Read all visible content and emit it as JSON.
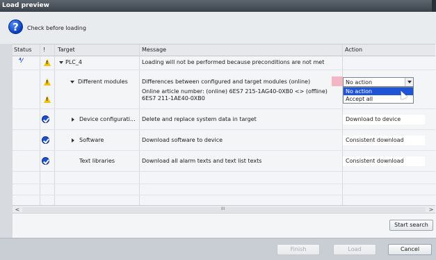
{
  "window": {
    "title": "Load preview"
  },
  "header": {
    "text": "Check before loading"
  },
  "columns": {
    "status": "Status",
    "bang": "!",
    "target": "Target",
    "message": "Message",
    "action": "Action"
  },
  "rows": [
    {
      "target": "PLC_4",
      "message": "Loading will not be performed because preconditions are not met",
      "action": ""
    },
    {
      "target": "Different modules",
      "message": "Differences between configured and target modules (online)",
      "action": "No action"
    },
    {
      "target": "",
      "message_line1": "Online article number: (online) 6ES7 215-1AG40-0XB0 <> (offline)",
      "message_line2": "6ES7 211-1AE40-0XB0",
      "action": ""
    },
    {
      "target": "Device configurati...",
      "message": "Delete and replace system data in target",
      "action": "Download to device"
    },
    {
      "target": "Software",
      "message": "Download software to device",
      "action": "Consistent download"
    },
    {
      "target": "Text libraries",
      "message": "Download all alarm texts and text list texts",
      "action": "Consistent download"
    }
  ],
  "dropdown": {
    "selected": "No action",
    "options": [
      "No action",
      "Accept all"
    ]
  },
  "scrollbar": {
    "left_arrow": "<",
    "right_arrow": ">",
    "grip": "III"
  },
  "buttons": {
    "start_search": "Start search",
    "finish": "Finish",
    "load": "Load",
    "cancel": "Cancel"
  },
  "colors": {
    "titlebar": "#3b4249",
    "selection": "#1f54d6",
    "warning": "#f2c100",
    "ok": "#1e4fd1",
    "error_mark": "#f2b6c4"
  }
}
